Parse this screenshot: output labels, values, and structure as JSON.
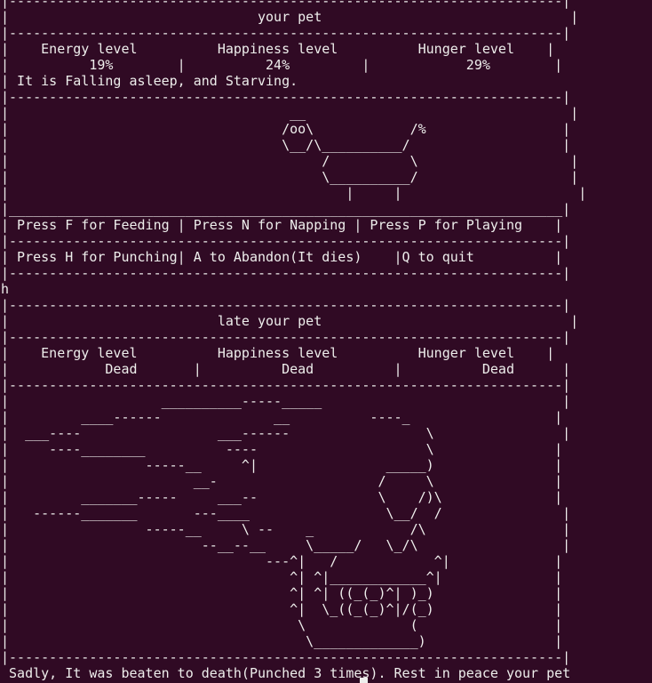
{
  "terminal": {
    "lines": [
      "|---------------------------------------------------------------------|",
      "|                               your pet                               |",
      "|---------------------------------------------------------------------|",
      "|    Energy level          Happiness level          Hunger level    |",
      "|          19%        |          24%         |            29%        |",
      "| It is Falling asleep, and Starving.",
      "|---------------------------------------------------------------------|",
      "|                                   __                                 |",
      "|                                  /oo\\            /%                 |",
      "|                                  \\__/\\__________/                   |",
      "|                                       /          \\                   |",
      "|                                       \\__________/                   |",
      "|                                          |     |                      |",
      "|_____________________________________________________________________|",
      "| Press F for Feeding | Press N for Napping | Press P for Playing    |",
      "|---------------------------------------------------------------------|",
      "| Press H for Punching| A to Abandon(It dies)    |Q to quit          |",
      "|---------------------------------------------------------------------|",
      "h",
      "|---------------------------------------------------------------------|",
      "|                          late your pet                               |",
      "|---------------------------------------------------------------------|",
      "|    Energy level          Happiness level          Hunger level    |",
      "|            Dead       |          Dead          |          Dead      |",
      "|---------------------------------------------------------------------|",
      "|                   __________-----_____                              |",
      "|         ____------              __          ----_                  |",
      "|  ___----                 ___------                 \\                |",
      "|     ----________          ----                     \\               |",
      "|                 -----__     ^|                _____)               |",
      "|                       __-                    /     \\               |",
      "|         _______-----     ___--               \\    /)\\              |",
      "|   ------_______       ---____                 \\__/  /               |",
      "|                 -----__     \\ --    _            /\\                 |",
      "|                        --__--__     \\_____/   \\_/\\                  |",
      "|                                ---^|   /            ^|             |",
      "|                                   ^| ^|____________^|              |",
      "|                                   ^| ^| ((_(_)^| )_)               |",
      "|                                   ^|  \\_((_(_)^|/(_)               |",
      "|                                    \\             (                 |",
      "|                                     \\_____________)                |",
      "|---------------------------------------------------------------------|",
      " Sadly, It was beaten to death(Punched 3 times). Rest in peace your pet"
    ]
  }
}
